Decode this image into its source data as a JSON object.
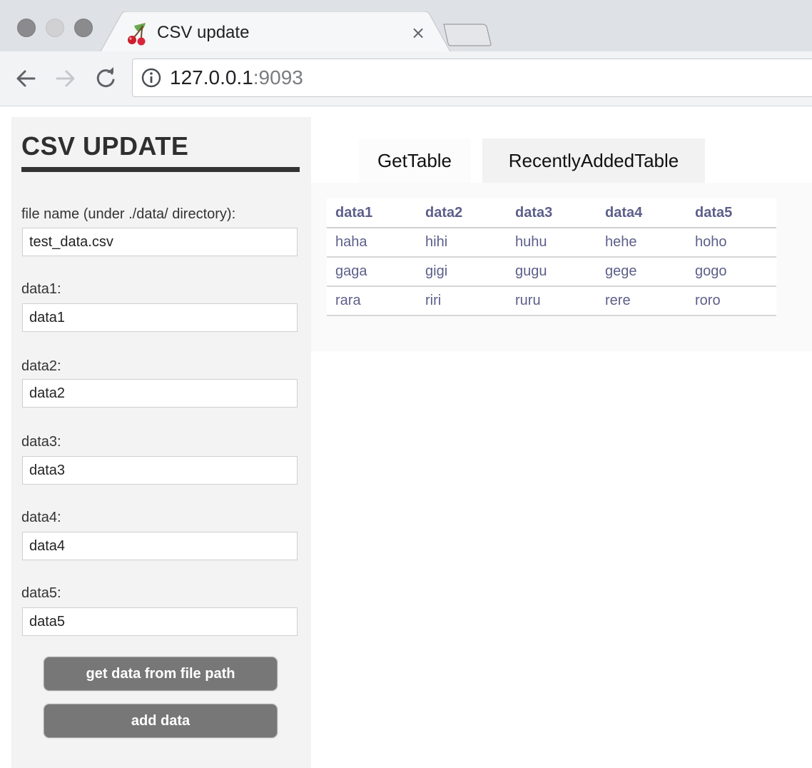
{
  "browser": {
    "tab_title": "CSV update",
    "tab_close_glyph": "×",
    "url_host": "127.0.0.1",
    "url_port": ":9093",
    "icons": [
      "cherry-favicon-icon",
      "back-icon",
      "forward-icon",
      "reload-icon",
      "info-icon",
      "close-icon",
      "new-tab-icon"
    ]
  },
  "sidebar": {
    "title": "CSV UPDATE",
    "filename": {
      "label": "file name (under ./data/ directory):",
      "value": "test_data.csv"
    },
    "fields": [
      {
        "label": "data1:",
        "value": "data1"
      },
      {
        "label": "data2:",
        "value": "data2"
      },
      {
        "label": "data3:",
        "value": "data3"
      },
      {
        "label": "data4:",
        "value": "data4"
      },
      {
        "label": "data5:",
        "value": "data5"
      }
    ],
    "buttons": {
      "get": "get data from file path",
      "add": "add data"
    }
  },
  "tabs": [
    {
      "label": "GetTable",
      "active": true
    },
    {
      "label": "RecentlyAddedTable",
      "active": false
    }
  ],
  "table": {
    "headers": [
      "data1",
      "data2",
      "data3",
      "data4",
      "data5"
    ],
    "rows": [
      [
        "haha",
        "hihi",
        "huhu",
        "hehe",
        "hoho"
      ],
      [
        "gaga",
        "gigi",
        "gugu",
        "gege",
        "gogo"
      ],
      [
        "rara",
        "riri",
        "ruru",
        "rere",
        "roro"
      ]
    ]
  },
  "colors": {
    "sidebar_bg": "#f3f3f3",
    "button_bg": "#777777",
    "table_text": "#5c5f8a",
    "title_rule": "#333333"
  }
}
